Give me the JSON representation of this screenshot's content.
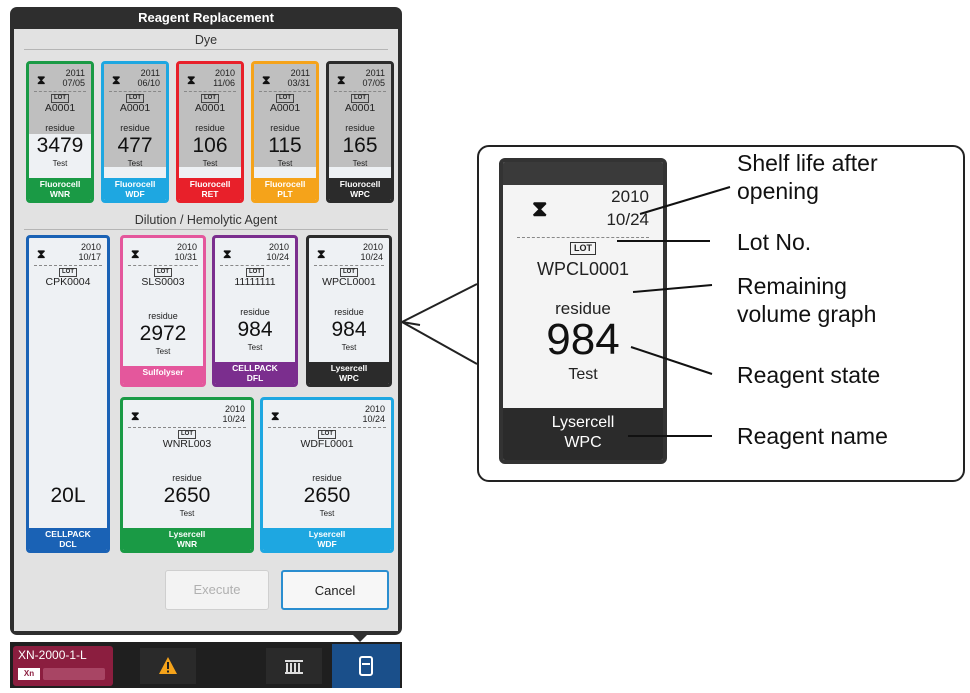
{
  "dialog": {
    "title": "Reagent Replacement",
    "dye_section": "Dye",
    "dilution_section": "Dilution / Hemolytic Agent",
    "execute_label": "Execute",
    "cancel_label": "Cancel"
  },
  "dye_cards": [
    {
      "year": "2011",
      "date": "07/05",
      "lot_badge": "LOT",
      "lot": "A0001",
      "residue_label": "residue",
      "residue": "3479",
      "unit": "Test",
      "name1": "Fluorocell",
      "name2": "WNR",
      "color": "#1a9a45"
    },
    {
      "year": "2011",
      "date": "06/10",
      "lot_badge": "LOT",
      "lot": "A0001",
      "residue_label": "residue",
      "residue": "477",
      "unit": "Test",
      "name1": "Fluorocell",
      "name2": "WDF",
      "color": "#1ea7e1"
    },
    {
      "year": "2010",
      "date": "11/06",
      "lot_badge": "LOT",
      "lot": "A0001",
      "residue_label": "residue",
      "residue": "106",
      "unit": "Test",
      "name1": "Fluorocell",
      "name2": "RET",
      "color": "#e8202a"
    },
    {
      "year": "2011",
      "date": "03/31",
      "lot_badge": "LOT",
      "lot": "A0001",
      "residue_label": "residue",
      "residue": "115",
      "unit": "Test",
      "name1": "Fluorocell",
      "name2": "PLT",
      "color": "#f5a31a"
    },
    {
      "year": "2011",
      "date": "07/05",
      "lot_badge": "LOT",
      "lot": "A0001",
      "residue_label": "residue",
      "residue": "165",
      "unit": "Test",
      "name1": "Fluorocell",
      "name2": "WPC",
      "color": "#2b2b2b"
    }
  ],
  "dil_cards": [
    {
      "year": "2010",
      "date": "10/17",
      "lot_badge": "LOT",
      "lot": "CPK0004",
      "residue_label": "",
      "residue": "20L",
      "unit": "",
      "name1": "CELLPACK",
      "name2": "DCL",
      "color": "#1a62b5"
    },
    {
      "year": "2010",
      "date": "10/31",
      "lot_badge": "LOT",
      "lot": "SLS0003",
      "residue_label": "residue",
      "residue": "2972",
      "unit": "Test",
      "name1": "Sulfolyser",
      "name2": "",
      "color": "#e4579c"
    },
    {
      "year": "2010",
      "date": "10/24",
      "lot_badge": "LOT",
      "lot": "11111111",
      "residue_label": "residue",
      "residue": "984",
      "unit": "Test",
      "name1": "CELLPACK",
      "name2": "DFL",
      "color": "#7b2e8e"
    },
    {
      "year": "2010",
      "date": "10/24",
      "lot_badge": "LOT",
      "lot": "WPCL0001",
      "residue_label": "residue",
      "residue": "984",
      "unit": "Test",
      "name1": "Lysercell",
      "name2": "WPC",
      "color": "#2b2b2b"
    },
    {
      "year": "2010",
      "date": "10/24",
      "lot_badge": "LOT",
      "lot": "WNRL003",
      "residue_label": "residue",
      "residue": "2650",
      "unit": "Test",
      "name1": "Lysercell",
      "name2": "WNR",
      "color": "#1a9a45"
    },
    {
      "year": "2010",
      "date": "10/24",
      "lot_badge": "LOT",
      "lot": "WDFL0001",
      "residue_label": "residue",
      "residue": "2650",
      "unit": "Test",
      "name1": "Lysercell",
      "name2": "WDF",
      "color": "#1ea7e1"
    }
  ],
  "status_bar": {
    "analyzer": "XN-2000-1-L",
    "xn_badge": "Xn",
    "warning_icon": "warning-icon",
    "rack_icon": "rack-icon",
    "reagent_icon": "reagent-icon"
  },
  "callout": {
    "year": "2010",
    "date": "10/24",
    "lot_badge": "LOT",
    "lot": "WPCL0001",
    "residue_label": "residue",
    "residue": "984",
    "unit": "Test",
    "name1": "Lysercell",
    "name2": "WPC",
    "ann_shelf_1": "Shelf life after",
    "ann_shelf_2": "opening",
    "ann_lot": "Lot No.",
    "ann_remaining_1": "Remaining",
    "ann_remaining_2": "volume graph",
    "ann_state": "Reagent state",
    "ann_name": "Reagent name"
  },
  "colors": {
    "dialog_frame": "#2e2e2e",
    "panel": "#e2e2e2",
    "status_bar": "#1f1f1f",
    "active_tab": "#1a4f8a"
  }
}
